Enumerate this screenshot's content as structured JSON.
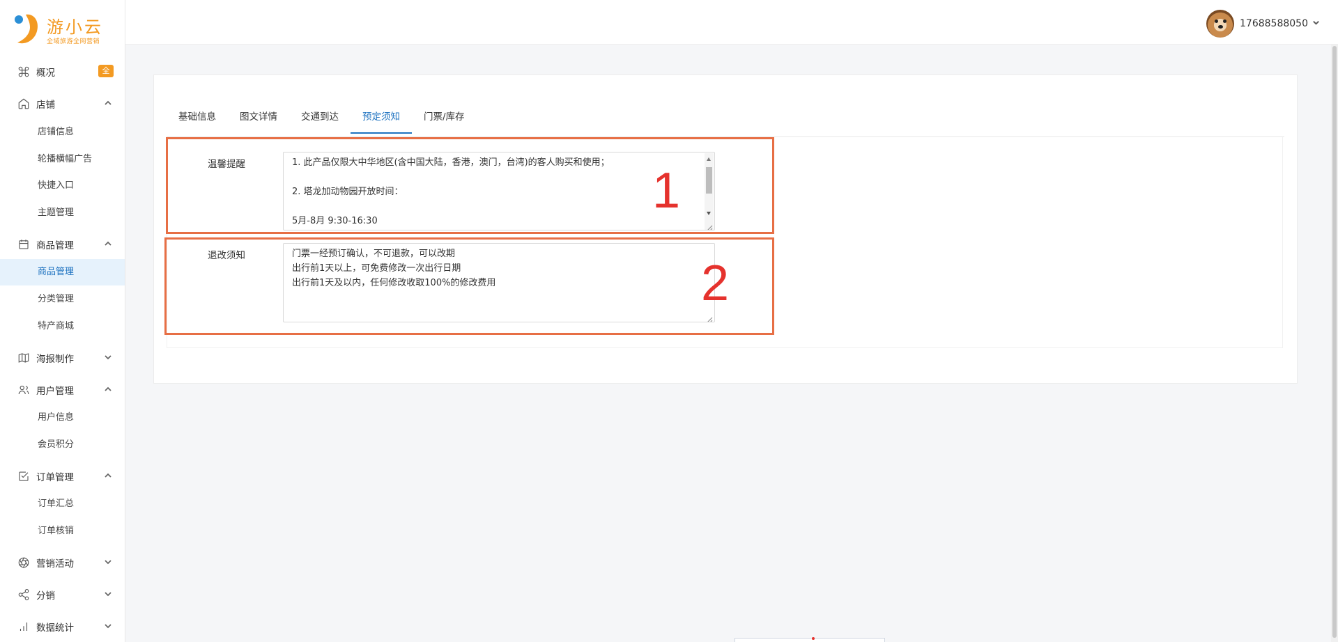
{
  "brand": {
    "name": "游小云",
    "tagline": "全域旅游全网营销"
  },
  "header": {
    "username": "17688588050"
  },
  "sidebar": {
    "overview": {
      "label": "概况",
      "badge": "全"
    },
    "shop": {
      "label": "店铺",
      "items": [
        "店铺信息",
        "轮播横幅广告",
        "快捷入口",
        "主题管理"
      ]
    },
    "goods": {
      "label": "商品管理",
      "items": [
        "商品管理",
        "分类管理",
        "特产商城"
      ],
      "active": "商品管理"
    },
    "poster": {
      "label": "海报制作"
    },
    "users": {
      "label": "用户管理",
      "items": [
        "用户信息",
        "会员积分"
      ]
    },
    "orders": {
      "label": "订单管理",
      "items": [
        "订单汇总",
        "订单核销"
      ]
    },
    "marketing": {
      "label": "营销活动"
    },
    "distribution": {
      "label": "分销"
    },
    "stats": {
      "label": "数据统计"
    }
  },
  "tabs": {
    "items": [
      "基础信息",
      "图文详情",
      "交通到达",
      "预定须知",
      "门票/库存"
    ],
    "active": "预定须知"
  },
  "form": {
    "reminder": {
      "label": "温馨提醒",
      "lines": [
        "1. 此产品仅限大中华地区(含中国大陆，香港，澳门，台湾)的客人购买和使用；",
        "",
        "2. 塔龙加动物园开放时间：",
        "",
        "5月-8月 9:30-16:30"
      ]
    },
    "refund": {
      "label": "退改须知",
      "lines": [
        "门票一经预订确认，不可退款，可以改期",
        "出行前1天以上，可免费修改一次出行日期",
        "出行前1天及以内，任何修改收取100%的修改费用"
      ]
    }
  },
  "annotations": {
    "box1": "1",
    "box2": "2",
    "color": "#e76f45"
  }
}
